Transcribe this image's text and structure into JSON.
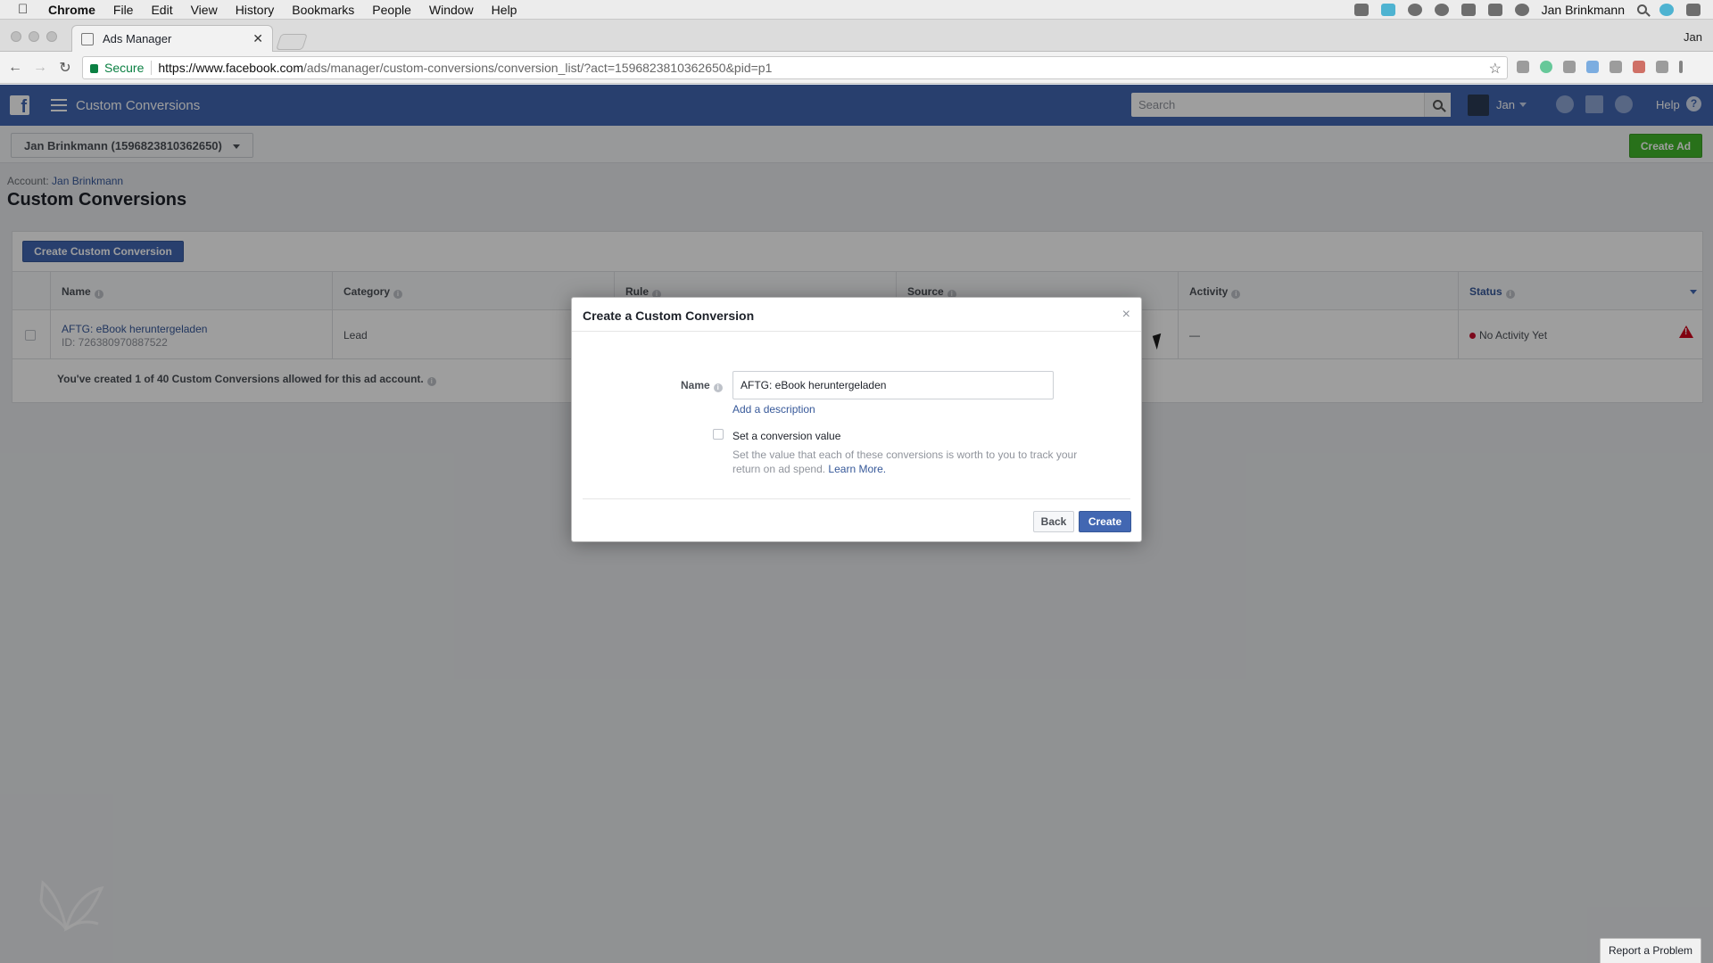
{
  "menubar": {
    "app": "Chrome",
    "items": [
      "File",
      "Edit",
      "View",
      "History",
      "Bookmarks",
      "People",
      "Window",
      "Help"
    ],
    "user": "Jan Brinkmann"
  },
  "browser": {
    "tab_title": "Ads Manager",
    "profile": "Jan",
    "secure_label": "Secure",
    "url_host": "https://www.facebook.com",
    "url_path": "/ads/manager/custom-conversions/conversion_list/?act=1596823810362650&pid=p1"
  },
  "fbbar": {
    "title": "Custom Conversions",
    "search_placeholder": "Search",
    "user": "Jan",
    "help": "Help"
  },
  "account": {
    "selector": "Jan Brinkmann (1596823810362650)",
    "create_ad": "Create Ad",
    "breadcrumb_label": "Account:",
    "breadcrumb_link": "Jan Brinkmann",
    "page_title": "Custom Conversions"
  },
  "table": {
    "create_button": "Create Custom Conversion",
    "columns": [
      "Name",
      "Category",
      "Rule",
      "Source",
      "Activity",
      "Status"
    ],
    "rows": [
      {
        "name": "AFTG: eBook heruntergeladen",
        "id": "ID: 726380970887522",
        "category": "Lead",
        "activity": "—",
        "status": "No Activity Yet"
      }
    ],
    "footer": "You've created 1 of 40 Custom Conversions allowed for this ad account."
  },
  "modal": {
    "title": "Create a Custom Conversion",
    "close": "×",
    "name_label": "Name",
    "name_value": "AFTG: eBook heruntergeladen",
    "add_description": "Add a description",
    "conversion_value_label": "Set a conversion value",
    "conversion_value_help": "Set the value that each of these conversions is worth to you to track your return on ad spend.",
    "learn_more": "Learn More.",
    "back": "Back",
    "create": "Create"
  },
  "report": "Report a Problem"
}
